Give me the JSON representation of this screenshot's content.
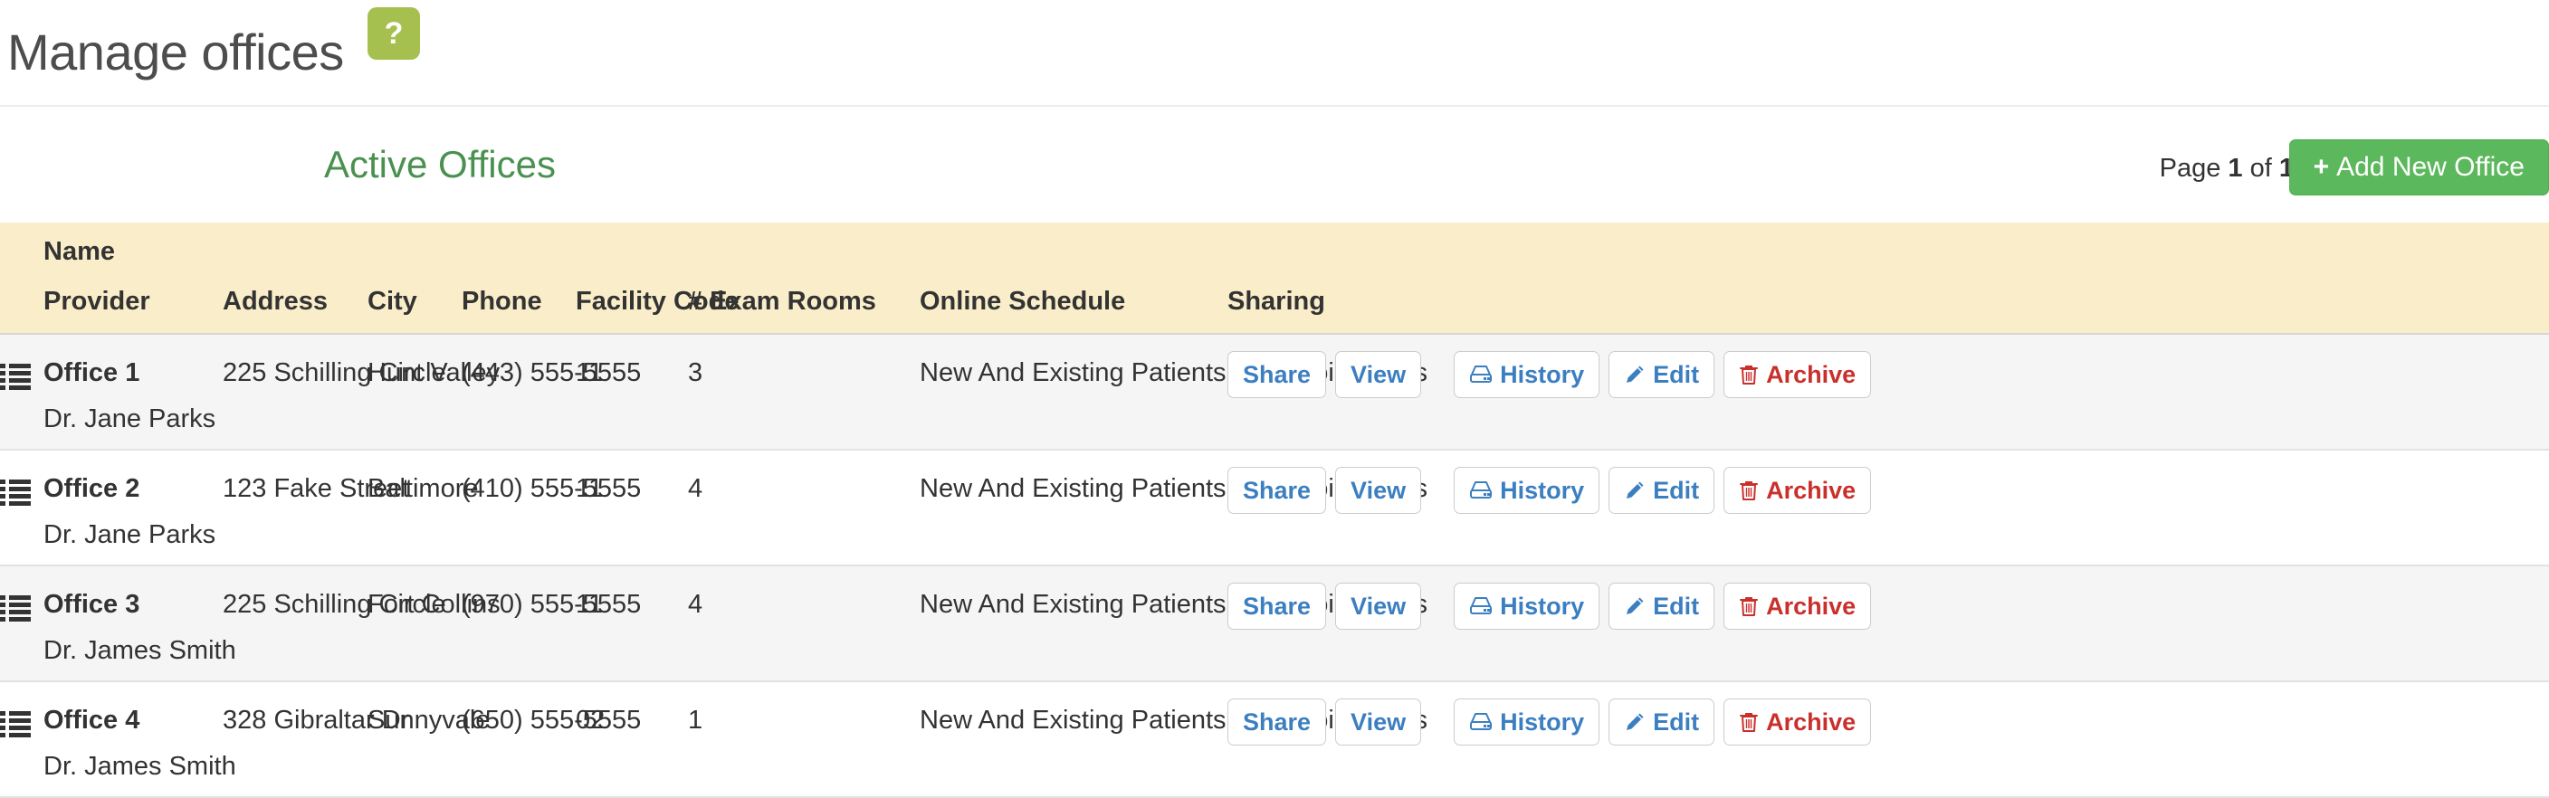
{
  "header": {
    "title": "Manage offices",
    "help_label": "?",
    "help_icon": "question-mark-icon"
  },
  "toolbar": {
    "section_title": "Active Offices",
    "pager_prefix": "Page",
    "pager_current": "1",
    "pager_middle": "of",
    "pager_total": "1",
    "add_button_label": "Add New Office",
    "add_button_plus": "+"
  },
  "table": {
    "columns": {
      "name": "Name",
      "provider": "Provider",
      "address": "Address",
      "city": "City",
      "phone": "Phone",
      "facility_code": "Facility Code",
      "exam_rooms": "# Exam Rooms",
      "online_schedule": "Online Schedule",
      "sharing": "Sharing"
    },
    "rows": [
      {
        "name": "Office 1",
        "provider": "Dr. Jane Parks",
        "address": "225 Schilling Circle",
        "city": "Hunt Valley",
        "phone": "(443) 555-5555",
        "facility_code": "11",
        "exam_rooms": "3",
        "online_schedule": "New And Existing Patients All Appointments"
      },
      {
        "name": "Office 2",
        "provider": "Dr. Jane Parks",
        "address": "123 Fake Street",
        "city": "Baltimore",
        "phone": "(410) 555-5555",
        "facility_code": "11",
        "exam_rooms": "4",
        "online_schedule": "New And Existing Patients All Appointments"
      },
      {
        "name": "Office 3",
        "provider": "Dr. James Smith",
        "address": "225 Schilling Circle",
        "city": "Fort Collins",
        "phone": "(970) 555-5555",
        "facility_code": "11",
        "exam_rooms": "4",
        "online_schedule": "New And Existing Patients All Appointments"
      },
      {
        "name": "Office 4",
        "provider": "Dr. James Smith",
        "address": "328 Gibraltar Dr",
        "city": "Sunnyvale",
        "phone": "(650) 555-5555",
        "facility_code": "02",
        "exam_rooms": "1",
        "online_schedule": "New And Existing Patients All Appointments"
      }
    ],
    "actions": {
      "share": "Share",
      "view": "View",
      "history": "History",
      "edit": "Edit",
      "archive": "Archive"
    },
    "icons": {
      "drag_handle": "list-handle-icon",
      "history": "hard-drive-icon",
      "edit": "pencil-icon",
      "archive": "trash-icon"
    }
  },
  "colors": {
    "help_green": "#a6c04f",
    "section_green": "#4a9150",
    "add_button_green": "#5cb85c",
    "header_row_cream": "#faeeca",
    "row_stripe": "#f5f5f5",
    "link_blue": "#3c7fc0",
    "danger_red": "#c9302c"
  }
}
